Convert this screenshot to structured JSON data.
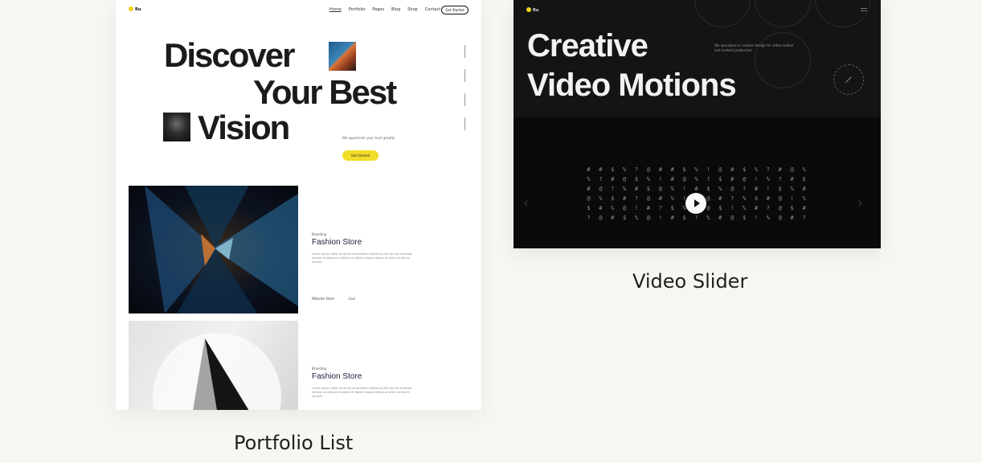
{
  "cards": [
    {
      "caption": "Portfolio List",
      "preview": {
        "logo_text": "Ru",
        "nav_items": [
          "Home",
          "Portfolio",
          "Pages",
          "Blog",
          "Shop",
          "Contact"
        ],
        "header_button": "Get Started",
        "heading_lines": [
          "Discover",
          "Your Best",
          "Vision"
        ],
        "subheading": "We appreciate your trust greatly",
        "cta_button": "Get Started",
        "projects": [
          {
            "category": "Branding",
            "title": "Fashion Store",
            "description": "Lorem ipsum dolor sit amet consectetur adipiscing elit sed do eiusmod tempor incididunt ut labore et dolore magna aliqua ut enim ad minim veniam",
            "links": [
              "Website Store",
              "Live"
            ]
          },
          {
            "category": "Branding",
            "title": "Fashion Store",
            "description": "Lorem ipsum dolor sit amet consectetur adipiscing elit sed do eiusmod tempor incididunt ut labore et dolore magna aliqua ut enim ad minim veniam"
          }
        ]
      }
    },
    {
      "caption": "Video Slider",
      "preview": {
        "logo_text": "Ru",
        "heading_lines": [
          "Creative",
          "Video Motions"
        ],
        "description": "We specialize in creative design for video motion and content production",
        "glyph_rows": [
          "##$%?@##$%!@#$%?#@%",
          "%?#@$%!#@%?$#@!%?#$",
          "#@?%#$@%!#$%@?#!$%#",
          "@%$#?@#%!$@#?%$#@!%",
          "$#%@!#?$%#@$!%#?@$#",
          "?@#$%@!#$?%#@$!%@#?"
        ]
      }
    }
  ],
  "colors": {
    "background": "#f6f6f2",
    "accent_yellow": "#f2d21b",
    "dark": "#0a0a0a"
  }
}
